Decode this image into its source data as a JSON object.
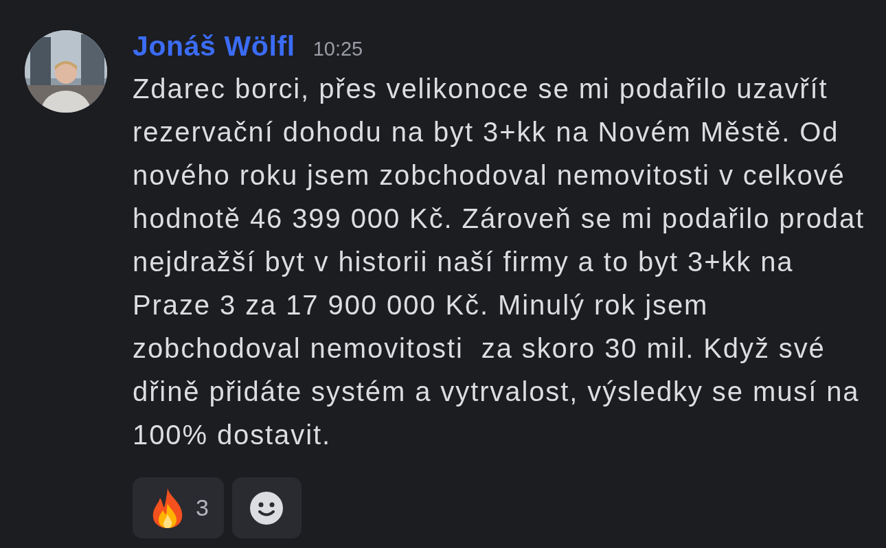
{
  "message": {
    "author": "Jonáš Wölfl",
    "time": "10:25",
    "text": "Zdarec borci, přes velikonoce se mi podařilo uzavřít rezervační dohodu na byt 3+kk na Novém Městě. Od nového roku jsem zobchodoval nemovitosti v celkové hodnotě 46 399 000 Kč. Zároveň se mi podařilo prodat nejdražší byt v historii naší firmy a to byt 3+kk na Praze 3 za 17 900 000 Kč. Minulý rok jsem zobchodoval nemovitosti  za skoro 30 mil. Když své dřině přidáte systém a vytrvalost, výsledky se musí na 100% dostavit.",
    "reactions": [
      {
        "kind": "fire",
        "count": "3",
        "selected": false
      }
    ]
  }
}
